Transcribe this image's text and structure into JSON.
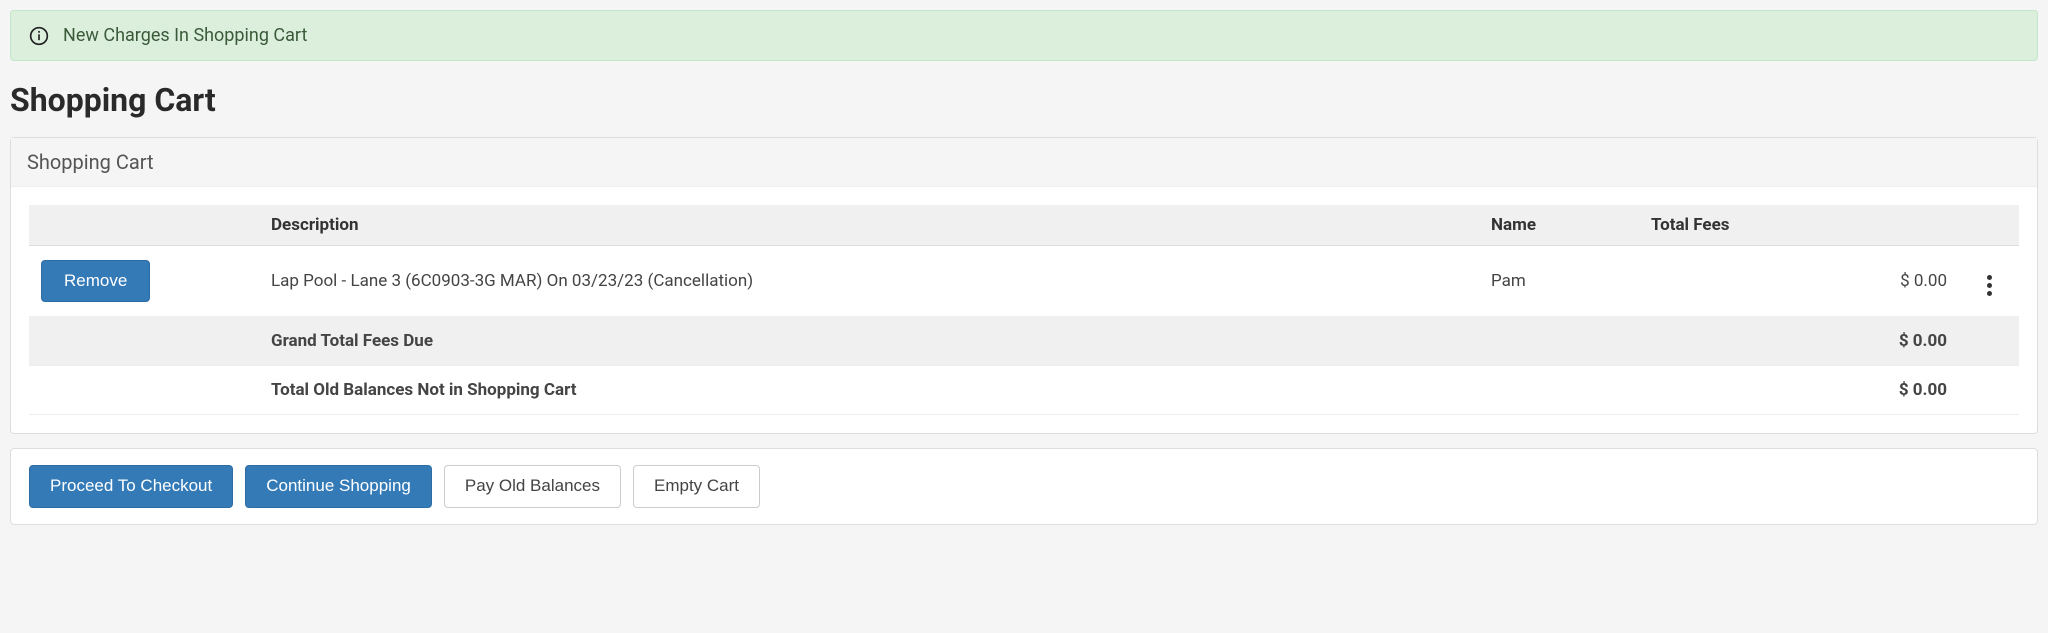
{
  "alert": {
    "message": "New Charges In Shopping Cart"
  },
  "page": {
    "title": "Shopping Cart"
  },
  "panel": {
    "header": "Shopping Cart"
  },
  "table": {
    "headers": {
      "description": "Description",
      "name": "Name",
      "total_fees": "Total Fees"
    },
    "rows": [
      {
        "remove_label": "Remove",
        "description": "Lap Pool - Lane 3 (6C0903-3G MAR) On 03/23/23 (Cancellation)",
        "name": "Pam",
        "amount": "$ 0.00"
      }
    ],
    "totals": {
      "grand_label": "Grand Total Fees Due",
      "grand_amount": "$ 0.00",
      "old_label": "Total Old Balances Not in Shopping Cart",
      "old_amount": "$ 0.00"
    }
  },
  "actions": {
    "checkout": "Proceed To Checkout",
    "continue": "Continue Shopping",
    "pay_old": "Pay Old Balances",
    "empty": "Empty Cart"
  }
}
